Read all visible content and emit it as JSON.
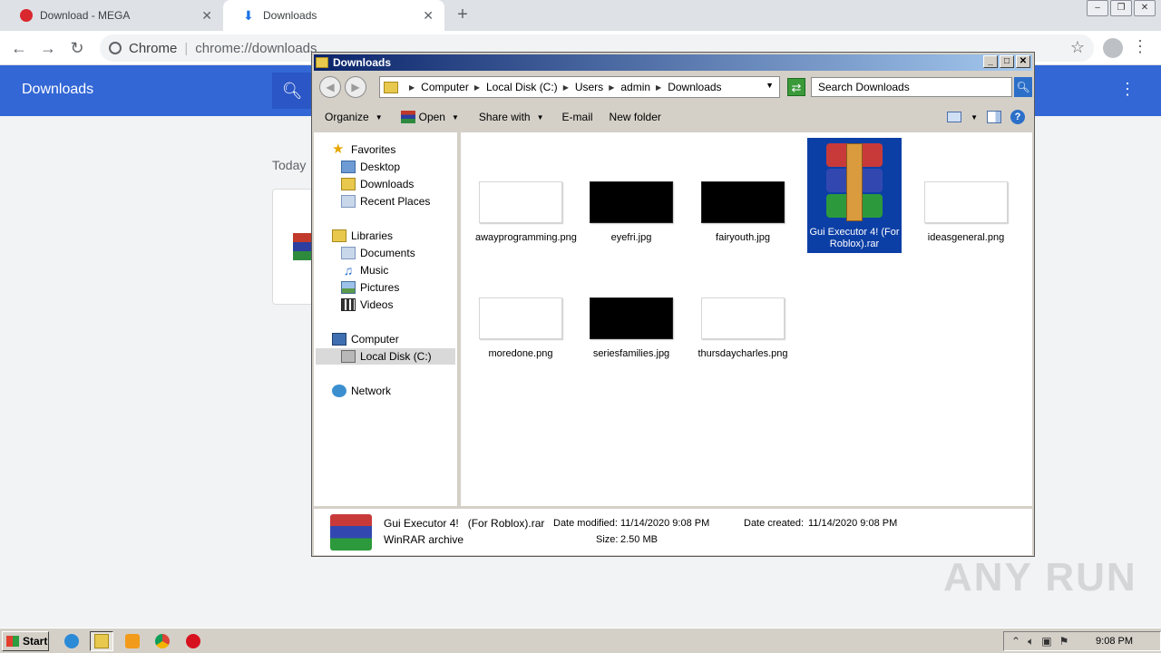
{
  "chrome": {
    "tabs": [
      {
        "label": "Download - MEGA",
        "active": false
      },
      {
        "label": "Downloads",
        "active": true
      }
    ],
    "address": {
      "site": "Chrome",
      "url": "chrome://downloads"
    },
    "page": {
      "title": "Downloads",
      "section_label": "Today"
    }
  },
  "explorer": {
    "title": "Downloads",
    "breadcrumbs": [
      "Computer",
      "Local Disk (C:)",
      "Users",
      "admin",
      "Downloads"
    ],
    "search_placeholder": "Search Downloads",
    "commands": {
      "organize": "Organize",
      "open": "Open",
      "share": "Share with",
      "email": "E-mail",
      "new_folder": "New folder"
    },
    "nav": {
      "favorites": "Favorites",
      "desktop": "Desktop",
      "downloads": "Downloads",
      "recent": "Recent Places",
      "libraries": "Libraries",
      "documents": "Documents",
      "music": "Music",
      "pictures": "Pictures",
      "videos": "Videos",
      "computer": "Computer",
      "local_disk": "Local Disk (C:)",
      "network": "Network"
    },
    "files": [
      {
        "name": "awayprogramming.png",
        "thumb": "light"
      },
      {
        "name": "eyefri.jpg",
        "thumb": "dark"
      },
      {
        "name": "fairyouth.jpg",
        "thumb": "dark"
      },
      {
        "name": "Gui Executor 4! (For Roblox).rar",
        "thumb": "rar",
        "selected": true
      },
      {
        "name": "ideasgeneral.png",
        "thumb": "light"
      },
      {
        "name": "moredone.png",
        "thumb": "light"
      },
      {
        "name": "seriesfamilies.jpg",
        "thumb": "dark"
      },
      {
        "name": "thursdaycharles.png",
        "thumb": "light"
      }
    ],
    "details": {
      "name": "Gui Executor 4!   (For Roblox).rar",
      "type": "WinRAR archive",
      "modified_label": "Date modified:",
      "modified": "11/14/2020 9:08 PM",
      "created_label": "Date created:",
      "created": "11/14/2020 9:08 PM",
      "size_label": "Size:",
      "size": "2.50 MB"
    }
  },
  "watermark": "ANY RUN",
  "taskbar": {
    "start": "Start",
    "clock": "9:08 PM"
  }
}
